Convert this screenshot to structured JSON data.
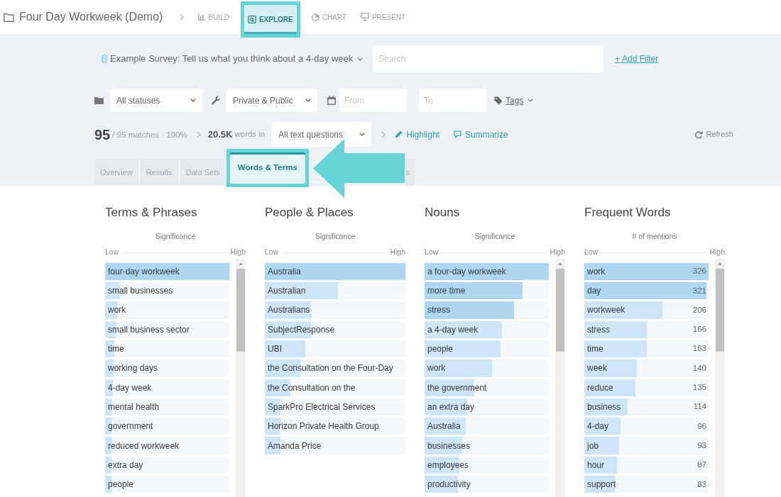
{
  "app_bar": {
    "title": "Four Day Workweek (Demo)",
    "nav": [
      {
        "label": "BUILD",
        "selected": false,
        "highlighted": false
      },
      {
        "label": "EXPLORE",
        "selected": true,
        "highlighted": true
      },
      {
        "label": "CHART",
        "selected": false,
        "highlighted": false
      },
      {
        "label": "PRESENT",
        "selected": false,
        "highlighted": false
      }
    ]
  },
  "filters": {
    "survey": "Example Survey: Tell us what you think about a 4-day week",
    "search": {
      "placeholder": "Search"
    },
    "add_filter": "+ Add Filter",
    "status": "All statuses",
    "visibility": "Private & Public",
    "date_from": {
      "placeholder": "From"
    },
    "date_to": {
      "placeholder": "To"
    },
    "tags": "Tags"
  },
  "summary": {
    "matches": "95",
    "matches_detail": "/ 95 matches · 100%",
    "words": "20.5K",
    "words_suffix": "words in",
    "question": "All text questions",
    "highlight": "Highlight",
    "summarize": "Summarize",
    "refresh": "Refresh"
  },
  "tabs": [
    {
      "label": "Overview",
      "selected": false,
      "highlighted": false
    },
    {
      "label": "Results",
      "selected": false,
      "highlighted": false
    },
    {
      "label": "Data Sets",
      "selected": false,
      "highlighted": false
    },
    {
      "label": "Words & Terms",
      "selected": true,
      "highlighted": true
    },
    {
      "label": "s",
      "selected": false,
      "highlighted": false
    }
  ],
  "columns": [
    {
      "title": "Terms & Phrases",
      "measure": "Significance",
      "low": "Low",
      "high": "High",
      "scrollable": true,
      "rows": [
        {
          "term": "four-day workweek",
          "level": 1
        },
        {
          "term": "small businesses",
          "level": 0.12
        },
        {
          "term": "work",
          "level": 0.095
        },
        {
          "term": "small business sector",
          "level": 0.09
        },
        {
          "term": "time",
          "level": 0.076
        },
        {
          "term": "working days",
          "level": 0.067
        },
        {
          "term": "4-day week",
          "level": 0.06
        },
        {
          "term": "mental health",
          "level": 0.056
        },
        {
          "term": "government",
          "level": 0.054
        },
        {
          "term": "reduced workweek",
          "level": 0.05
        },
        {
          "term": "extra day",
          "level": 0.05
        },
        {
          "term": "people",
          "level": 0.05
        }
      ]
    },
    {
      "title": "People & Places",
      "measure": "Significance",
      "low": "Low",
      "high": "High",
      "scrollable": false,
      "rows": [
        {
          "term": "Australia",
          "level": 1
        },
        {
          "term": "Australian",
          "level": 0.52
        },
        {
          "term": "Australians",
          "level": 0.33
        },
        {
          "term": "SubjectResponse",
          "level": 0.33
        },
        {
          "term": "UBI",
          "level": 0.29
        },
        {
          "term": "the Consultation on the Four-Day",
          "level": 0.25
        },
        {
          "term": "the Consultation on the",
          "level": 0.18
        },
        {
          "term": "SparkPro Electrical Services",
          "level": 0.11
        },
        {
          "term": "Horizon Private Health Group",
          "level": 0.11
        },
        {
          "term": "Amanda Price",
          "level": 0.11
        }
      ]
    },
    {
      "title": "Nouns",
      "measure": "Significance",
      "low": "Low",
      "high": "High",
      "scrollable": true,
      "rows": [
        {
          "term": "a four-day workweek",
          "level": 1
        },
        {
          "term": "more time",
          "level": 0.79
        },
        {
          "term": "stress",
          "level": 0.72
        },
        {
          "term": "a 4-day week",
          "level": 0.62
        },
        {
          "term": "people",
          "level": 0.61
        },
        {
          "term": "work",
          "level": 0.54
        },
        {
          "term": "the government",
          "level": 0.4
        },
        {
          "term": "an extra day",
          "level": 0.34
        },
        {
          "term": "Australia",
          "level": 0.33
        },
        {
          "term": "businesses",
          "level": 0.3
        },
        {
          "term": "employees",
          "level": 0.28
        },
        {
          "term": "productivity",
          "level": 0.27
        }
      ]
    },
    {
      "title": "Frequent Words",
      "measure": "# of mentions",
      "low": "Low",
      "high": "High",
      "scrollable": true,
      "rows": [
        {
          "term": "work",
          "count": "326",
          "level": 1
        },
        {
          "term": "day",
          "count": "321",
          "level": 0.98
        },
        {
          "term": "workweek",
          "count": "206",
          "level": 0.63
        },
        {
          "term": "stress",
          "count": "166",
          "level": 0.5
        },
        {
          "term": "time",
          "count": "163",
          "level": 0.5
        },
        {
          "term": "week",
          "count": "140",
          "level": 0.42
        },
        {
          "term": "reduce",
          "count": "135",
          "level": 0.41
        },
        {
          "term": "business",
          "count": "114",
          "level": 0.35
        },
        {
          "term": "4-day",
          "count": "96",
          "level": 0.29
        },
        {
          "term": "job",
          "count": "93",
          "level": 0.28
        },
        {
          "term": "hour",
          "count": "87",
          "level": 0.26
        },
        {
          "term": "support",
          "count": "83",
          "level": 0.25
        }
      ]
    }
  ]
}
